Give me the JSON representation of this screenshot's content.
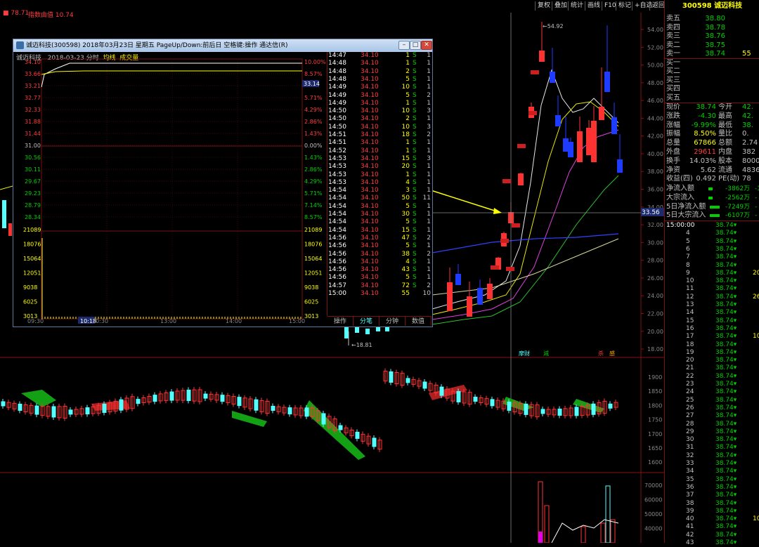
{
  "toolbar": [
    "复权",
    "叠加",
    "统计",
    "画线",
    "F10",
    "标记",
    "+自选",
    "返回"
  ],
  "legend": {
    "a": "78.71",
    "b": "指数由值 10.74"
  },
  "main_axis": [
    "54.00",
    "52.00",
    "50.00",
    "48.00",
    "46.00",
    "44.00",
    "42.00",
    "40.00",
    "38.00",
    "36.00",
    "34.00",
    "32.00",
    "30.00",
    "28.00",
    "26.00",
    "24.00",
    "22.00",
    "20.00",
    "18.00"
  ],
  "mid_axis": [
    "1900",
    "1850",
    "1800",
    "1750",
    "1700",
    "1650",
    "1600"
  ],
  "bot_axis": [
    "70000",
    "60000",
    "50000",
    "40000"
  ],
  "marks": {
    "high": "54.92",
    "low": "18.81",
    "crosshair": "33.56",
    "tags": [
      "摩财",
      "減",
      "杀",
      "感"
    ]
  },
  "stock": {
    "code": "300598",
    "name": "诚迈科技"
  },
  "orders": [
    {
      "label": "卖五",
      "price": "38.80",
      "vol": ""
    },
    {
      "label": "卖四",
      "price": "38.78",
      "vol": ""
    },
    {
      "label": "卖三",
      "price": "38.76",
      "vol": ""
    },
    {
      "label": "卖二",
      "price": "38.75",
      "vol": ""
    },
    {
      "label": "卖一",
      "price": "38.74",
      "vol": "55"
    },
    {
      "label": "买一",
      "price": "",
      "vol": ""
    },
    {
      "label": "买二",
      "price": "",
      "vol": ""
    },
    {
      "label": "买三",
      "price": "",
      "vol": ""
    },
    {
      "label": "买四",
      "price": "",
      "vol": ""
    },
    {
      "label": "买五",
      "price": "",
      "vol": ""
    }
  ],
  "quote": [
    {
      "l1": "现价",
      "v1": "38.74",
      "l2": "今开",
      "v2": "42."
    },
    {
      "l1": "涨跌",
      "v1": "-4.30",
      "l2": "最高",
      "v2": "42."
    },
    {
      "l1": "涨幅",
      "v1": "-9.99%",
      "l2": "最低",
      "v2": "38."
    },
    {
      "l1": "振幅",
      "v1": "8.50%",
      "l2": "量比",
      "v2": "0."
    },
    {
      "l1": "总量",
      "v1": "67866",
      "l2": "总额",
      "v2": "2.74"
    },
    {
      "l1": "外盘",
      "v1": "29611",
      "l2": "内盘",
      "v2": "382"
    },
    {
      "l1": "换手",
      "v1": "14.03%",
      "l2": "股本",
      "v2": "8000"
    },
    {
      "l1": "净资",
      "v1": "5.62",
      "l2": "流通",
      "v2": "4836"
    },
    {
      "l1": "收益(四)",
      "v1": "0.492",
      "l2": "PE(动)",
      "v2": "78"
    }
  ],
  "flows": [
    {
      "label": "净流入额",
      "val": "-3862万",
      "tail": "-1"
    },
    {
      "label": "大宗流入",
      "val": "-2562万",
      "tail": "-"
    },
    {
      "label": "5日净流入额",
      "val": "-7249万",
      "tail": "-"
    },
    {
      "label": "5日大宗流入",
      "val": "-6107万",
      "tail": "-"
    }
  ],
  "ticks_right": [
    {
      "t": "15:00:00",
      "p": "38.74",
      "v": ""
    },
    {
      "t": "4",
      "p": "38.74",
      "v": ""
    },
    {
      "t": "5",
      "p": "38.74",
      "v": ""
    },
    {
      "t": "6",
      "p": "38.74",
      "v": ""
    },
    {
      "t": "7",
      "p": "38.74",
      "v": ""
    },
    {
      "t": "8",
      "p": "38.74",
      "v": ""
    },
    {
      "t": "9",
      "p": "38.74",
      "v": "20"
    },
    {
      "t": "10",
      "p": "38.74",
      "v": ""
    },
    {
      "t": "11",
      "p": "38.74",
      "v": ""
    },
    {
      "t": "12",
      "p": "38.74",
      "v": "26"
    },
    {
      "t": "13",
      "p": "38.74",
      "v": ""
    },
    {
      "t": "14",
      "p": "38.74",
      "v": ""
    },
    {
      "t": "15",
      "p": "38.74",
      "v": ""
    },
    {
      "t": "16",
      "p": "38.74",
      "v": ""
    },
    {
      "t": "17",
      "p": "38.74",
      "v": "10"
    },
    {
      "t": "18",
      "p": "38.74",
      "v": ""
    },
    {
      "t": "19",
      "p": "38.74",
      "v": ""
    },
    {
      "t": "20",
      "p": "38.74",
      "v": ""
    },
    {
      "t": "21",
      "p": "38.74",
      "v": ""
    },
    {
      "t": "22",
      "p": "38.74",
      "v": ""
    },
    {
      "t": "23",
      "p": "38.74",
      "v": ""
    },
    {
      "t": "24",
      "p": "38.74",
      "v": ""
    },
    {
      "t": "25",
      "p": "38.74",
      "v": ""
    },
    {
      "t": "26",
      "p": "38.74",
      "v": ""
    },
    {
      "t": "27",
      "p": "38.74",
      "v": ""
    },
    {
      "t": "28",
      "p": "38.74",
      "v": ""
    },
    {
      "t": "29",
      "p": "38.74",
      "v": ""
    },
    {
      "t": "30",
      "p": "38.74",
      "v": ""
    },
    {
      "t": "31",
      "p": "38.74",
      "v": ""
    },
    {
      "t": "32",
      "p": "38.74",
      "v": ""
    },
    {
      "t": "33",
      "p": "38.74",
      "v": ""
    },
    {
      "t": "34",
      "p": "38.74",
      "v": ""
    },
    {
      "t": "35",
      "p": "38.74",
      "v": ""
    },
    {
      "t": "36",
      "p": "38.74",
      "v": ""
    },
    {
      "t": "37",
      "p": "38.74",
      "v": ""
    },
    {
      "t": "38",
      "p": "38.74",
      "v": ""
    },
    {
      "t": "39",
      "p": "38.74",
      "v": ""
    },
    {
      "t": "40",
      "p": "38.74",
      "v": "10"
    },
    {
      "t": "41",
      "p": "38.74",
      "v": ""
    },
    {
      "t": "42",
      "p": "38.74",
      "v": ""
    },
    {
      "t": "43",
      "p": "38.74",
      "v": ""
    }
  ],
  "popup": {
    "title": "诚迈科技(300598) 2018年03月23日 星期五 PageUp/Down:前后日 空格键:操作 通达信(R)",
    "sub_name": "诚迈科技",
    "sub_date": "2018-03-23 分时",
    "sub_avg": "均线",
    "sub_vol": "成交量",
    "left_prices": [
      "34.10",
      "33.66",
      "33.21",
      "32.77",
      "32.33",
      "31.88",
      "31.44",
      "31.00",
      "30.56",
      "30.11",
      "29.67",
      "29.23",
      "28.79",
      "28.34"
    ],
    "right_pcts": [
      "10.00%",
      "8.57%",
      "",
      "5.71%",
      "4.29%",
      "2.86%",
      "1.43%",
      "0.00%",
      "1.43%",
      "2.86%",
      "4.29%",
      "5.71%",
      "7.14%",
      "8.57%"
    ],
    "price_now": "33.14",
    "vol_left": [
      "21089",
      "18076",
      "15064",
      "12051",
      "9038",
      "6025",
      "3013"
    ],
    "vol_right": [
      "21089",
      "18076",
      "15064",
      "12051",
      "9038",
      "6025",
      "3013"
    ],
    "times": [
      "09:30",
      "10:18",
      "10:30",
      "13:00",
      "14:00",
      "15:00"
    ],
    "ticks": [
      {
        "t": "14:47",
        "p": "34.10",
        "v": "1",
        "s": "S",
        "n": "1"
      },
      {
        "t": "14:48",
        "p": "34.10",
        "v": "1",
        "s": "S",
        "n": "1"
      },
      {
        "t": "14:48",
        "p": "34.10",
        "v": "2",
        "s": "S",
        "n": "1"
      },
      {
        "t": "14:48",
        "p": "34.10",
        "v": "5",
        "s": "S",
        "n": "1"
      },
      {
        "t": "14:49",
        "p": "34.10",
        "v": "10",
        "s": "S",
        "n": "1"
      },
      {
        "t": "14:49",
        "p": "34.10",
        "v": "5",
        "s": "S",
        "n": "2"
      },
      {
        "t": "14:49",
        "p": "34.10",
        "v": "1",
        "s": "S",
        "n": "1"
      },
      {
        "t": "14:50",
        "p": "34.10",
        "v": "10",
        "s": "S",
        "n": "3"
      },
      {
        "t": "14:50",
        "p": "34.10",
        "v": "2",
        "s": "S",
        "n": "1"
      },
      {
        "t": "14:50",
        "p": "34.10",
        "v": "10",
        "s": "S",
        "n": "3"
      },
      {
        "t": "14:51",
        "p": "34.10",
        "v": "18",
        "s": "S",
        "n": "2"
      },
      {
        "t": "14:51",
        "p": "34.10",
        "v": "1",
        "s": "S",
        "n": "1"
      },
      {
        "t": "14:52",
        "p": "34.10",
        "v": "1",
        "s": "S",
        "n": "1"
      },
      {
        "t": "14:53",
        "p": "34.10",
        "v": "15",
        "s": "S",
        "n": "3"
      },
      {
        "t": "14:53",
        "p": "34.10",
        "v": "20",
        "s": "S",
        "n": "1"
      },
      {
        "t": "14:53",
        "p": "34.10",
        "v": "1",
        "s": "S",
        "n": "1"
      },
      {
        "t": "14:53",
        "p": "34.10",
        "v": "4",
        "s": "S",
        "n": "1"
      },
      {
        "t": "14:54",
        "p": "34.10",
        "v": "3",
        "s": "S",
        "n": "1"
      },
      {
        "t": "14:54",
        "p": "34.10",
        "v": "50",
        "s": "S",
        "n": "11"
      },
      {
        "t": "14:54",
        "p": "34.10",
        "v": "5",
        "s": "S",
        "n": "1"
      },
      {
        "t": "14:54",
        "p": "34.10",
        "v": "30",
        "s": "S",
        "n": "1"
      },
      {
        "t": "14:54",
        "p": "34.10",
        "v": "5",
        "s": "S",
        "n": "1"
      },
      {
        "t": "14:54",
        "p": "34.10",
        "v": "15",
        "s": "S",
        "n": "1"
      },
      {
        "t": "14:56",
        "p": "34.10",
        "v": "47",
        "s": "S",
        "n": "2"
      },
      {
        "t": "14:56",
        "p": "34.10",
        "v": "5",
        "s": "S",
        "n": "1"
      },
      {
        "t": "14:56",
        "p": "34.10",
        "v": "38",
        "s": "S",
        "n": "2"
      },
      {
        "t": "14:56",
        "p": "34.10",
        "v": "4",
        "s": "S",
        "n": "1"
      },
      {
        "t": "14:56",
        "p": "34.10",
        "v": "43",
        "s": "S",
        "n": "1"
      },
      {
        "t": "14:56",
        "p": "34.10",
        "v": "5",
        "s": "S",
        "n": "1"
      },
      {
        "t": "14:57",
        "p": "34.10",
        "v": "72",
        "s": "S",
        "n": "2"
      },
      {
        "t": "15:00",
        "p": "34.10",
        "v": "55",
        "s": "",
        "n": "10"
      }
    ],
    "tabs": [
      "操作",
      "分笔",
      "分钟",
      "数值"
    ]
  },
  "colors": {
    "up": "#ff3232",
    "down": "#54ffff",
    "green": "#00d000",
    "yellow": "#ffff00",
    "blue": "#1e3cff"
  }
}
